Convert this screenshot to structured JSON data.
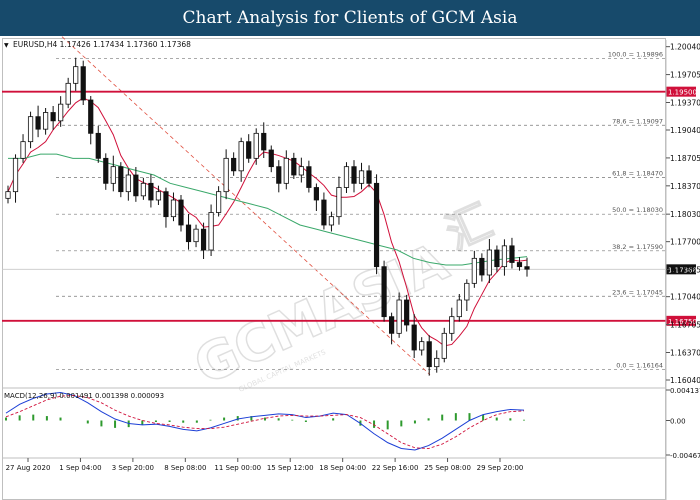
{
  "header": {
    "title": "Chart Analysis for Clients of GCM Asia"
  },
  "symbol": {
    "name": "EURUSD,H4",
    "ohlc": "1.17426 1.17434 1.17360 1.17368"
  },
  "watermark": {
    "text": "GCMASIA",
    "chinese": "汇",
    "tagline": "GLOBAL CAPITAL MARKETS"
  },
  "chart_data": [
    {
      "type": "candlestick",
      "title": "",
      "ylim": [
        1.1598,
        1.2012
      ],
      "price_ticks": [
        "1.20040",
        "1.19705",
        "1.19370",
        "1.19040",
        "1.18705",
        "1.18370",
        "1.18030",
        "1.17700",
        "1.17365",
        "1.17040",
        "1.16705",
        "1.16370",
        "1.16040"
      ],
      "current_price": "1.17368",
      "x_ticks": [
        "27 Aug 2020",
        "1 Sep 04:00",
        "3 Sep 20:00",
        "8 Sep 08:00",
        "11 Sep 00:00",
        "15 Sep 12:00",
        "18 Sep 04:00",
        "22 Sep 16:00",
        "25 Sep 08:00",
        "29 Sep 20:00"
      ],
      "horizontal_levels": [
        {
          "price": 1.195,
          "label": "1.19500",
          "color": "#d0103a"
        },
        {
          "price": 1.1675,
          "label": "1.16750",
          "color": "#d0103a"
        }
      ],
      "fib_levels": [
        {
          "price": 1.19896,
          "label": "100.0 = 1.19896"
        },
        {
          "price": 1.19097,
          "label": "78.6 = 1.19097"
        },
        {
          "price": 1.1847,
          "label": "61.8 = 1.18470"
        },
        {
          "price": 1.1803,
          "label": "50.0 = 1.18030"
        },
        {
          "price": 1.1759,
          "label": "38.2 = 1.17590"
        },
        {
          "price": 1.17045,
          "label": "23.6 = 1.17045"
        },
        {
          "price": 1.16164,
          "label": "0.0 = 1.16164"
        }
      ],
      "series": [
        {
          "name": "close",
          "values": [
            1.183,
            1.187,
            1.189,
            1.192,
            1.1905,
            1.1925,
            1.1915,
            1.1935,
            1.196,
            1.198,
            1.194,
            1.19,
            1.187,
            1.184,
            1.186,
            1.183,
            1.185,
            1.1825,
            1.184,
            1.182,
            1.183,
            1.18,
            1.182,
            1.179,
            1.177,
            1.1785,
            1.176,
            1.1805,
            1.183,
            1.187,
            1.1855,
            1.189,
            1.187,
            1.19,
            1.188,
            1.186,
            1.184,
            1.187,
            1.185,
            1.186,
            1.1835,
            1.182,
            1.179,
            1.18,
            1.1835,
            1.186,
            1.184,
            1.1855,
            1.184,
            1.174,
            1.168,
            1.166,
            1.17,
            1.167,
            1.164,
            1.165,
            1.162,
            1.163,
            1.166,
            1.168,
            1.17,
            1.172,
            1.175,
            1.173,
            1.176,
            1.174,
            1.1765,
            1.1745,
            1.174,
            1.1737
          ]
        },
        {
          "name": "ma_slow",
          "values": [
            1.187,
            1.187,
            1.1875,
            1.1875,
            1.187,
            1.187,
            1.1865,
            1.186,
            1.1855,
            1.185,
            1.184,
            1.1835,
            1.183,
            1.1825,
            1.182,
            1.1815,
            1.181,
            1.18,
            1.179,
            1.1785,
            1.178,
            1.1775,
            1.177,
            1.1765,
            1.176,
            1.175,
            1.1745,
            1.1742,
            1.1742,
            1.1745,
            1.1748,
            1.175,
            1.1752
          ]
        }
      ]
    },
    {
      "type": "line",
      "title": "MACD(12,26,9) 0.001491 0.001398 0.000093",
      "ylim": [
        -0.004679,
        0.004137
      ],
      "y_ticks": [
        "0.004137",
        "0.00",
        "-0.004679"
      ],
      "series": [
        {
          "name": "macd",
          "values": [
            0.001,
            0.0022,
            0.003,
            0.0036,
            0.0038,
            0.0034,
            0.0024,
            0.0012,
            0.0002,
            -0.0004,
            -0.0006,
            -0.0005,
            -0.0008,
            -0.0012,
            -0.0014,
            -0.001,
            -0.0004,
            0.0002,
            0.0005,
            0.0007,
            0.0009,
            0.0008,
            0.0004,
            0.0006,
            0.001,
            0.0008,
            -0.0004,
            -0.0018,
            -0.003,
            -0.0038,
            -0.004,
            -0.0034,
            -0.0024,
            -0.0012,
            0.0,
            0.0008,
            0.0012,
            0.0015,
            0.0014
          ]
        },
        {
          "name": "signal",
          "values": [
            0.0005,
            0.0012,
            0.002,
            0.0028,
            0.0033,
            0.0034,
            0.0031,
            0.0024,
            0.0014,
            0.0006,
            0.0,
            -0.0004,
            -0.0006,
            -0.0009,
            -0.0011,
            -0.0011,
            -0.0009,
            -0.0005,
            -0.0001,
            0.0003,
            0.0006,
            0.0007,
            0.0006,
            0.0006,
            0.0007,
            0.0008,
            0.0004,
            -0.0006,
            -0.0018,
            -0.003,
            -0.0037,
            -0.0038,
            -0.0032,
            -0.0022,
            -0.001,
            0.0,
            0.0008,
            0.0012,
            0.0013
          ]
        },
        {
          "name": "histogram",
          "values": [
            0.0004,
            0.0007,
            0.0008,
            0.0006,
            0.0004,
            0.0,
            -0.0004,
            -0.0008,
            -0.001,
            -0.0009,
            -0.0006,
            -0.0002,
            -0.0002,
            -0.0003,
            -0.0003,
            0.0001,
            0.0004,
            0.0006,
            0.0006,
            0.0004,
            0.0003,
            0.0001,
            -0.0002,
            0.0,
            0.0003,
            0.0,
            -0.0007,
            -0.001,
            -0.0012,
            -0.0008,
            -0.0004,
            0.0003,
            0.0008,
            0.001,
            0.001,
            0.0008,
            0.0004,
            0.0003,
            0.0001
          ]
        }
      ]
    }
  ]
}
